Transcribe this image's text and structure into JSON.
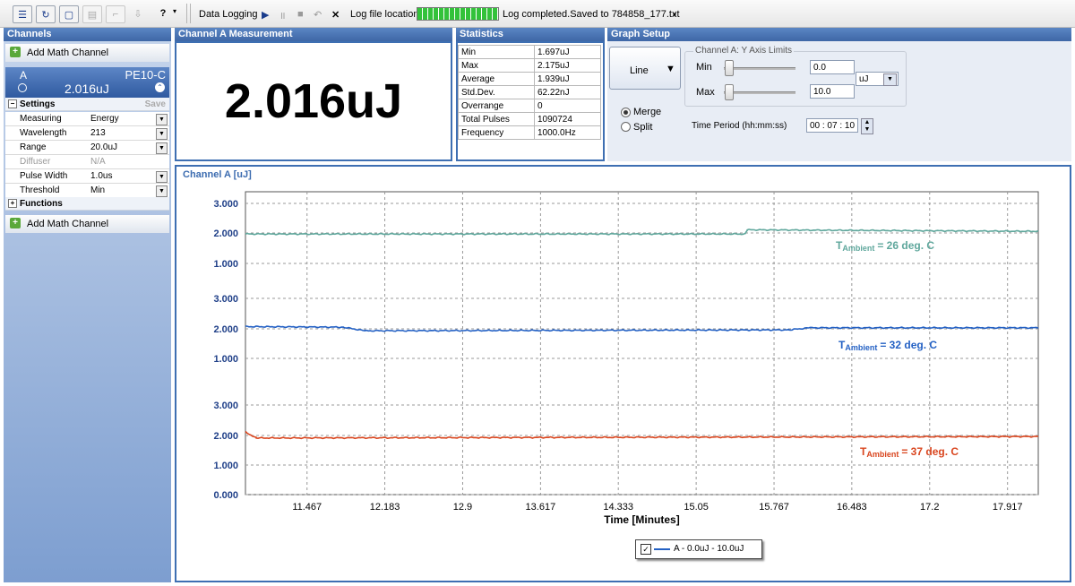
{
  "toolbar": {
    "data_logging": "Data Logging",
    "log_file_location": "Log file location",
    "log_status": "Log completed.Saved to 784858_177.txt"
  },
  "channels": {
    "title": "Channels",
    "add_math_label": "Add Math Channel",
    "channel": {
      "name": "A",
      "sensor": "PE10-C",
      "value": "2.016uJ"
    },
    "settings_label": "Settings",
    "save_label": "Save",
    "settings": [
      {
        "key": "Measuring",
        "value": "Energy",
        "dropdown": true,
        "disabled": false
      },
      {
        "key": "Wavelength",
        "value": "213",
        "dropdown": true,
        "disabled": false
      },
      {
        "key": "Range",
        "value": "20.0uJ",
        "dropdown": true,
        "disabled": false
      },
      {
        "key": "Diffuser",
        "value": "N/A",
        "dropdown": false,
        "disabled": true
      },
      {
        "key": "Pulse Width",
        "value": "1.0us",
        "dropdown": true,
        "disabled": false
      },
      {
        "key": "Threshold",
        "value": "Min",
        "dropdown": true,
        "disabled": false
      }
    ],
    "functions_label": "Functions"
  },
  "measurement": {
    "title": "Channel A Measurement",
    "value": "2.016uJ"
  },
  "statistics": {
    "title": "Statistics",
    "rows": [
      {
        "label": "Min",
        "value": "1.697uJ"
      },
      {
        "label": "Max",
        "value": "2.175uJ"
      },
      {
        "label": "Average",
        "value": "1.939uJ"
      },
      {
        "label": "Std.Dev.",
        "value": "62.22nJ"
      },
      {
        "label": "Overrange",
        "value": "0"
      },
      {
        "label": "Total Pulses",
        "value": "1090724"
      },
      {
        "label": "Frequency",
        "value": "1000.0Hz"
      }
    ]
  },
  "graph_setup": {
    "title": "Graph Setup",
    "graph_type": "Line",
    "merge_label": "Merge",
    "split_label": "Split",
    "mode_selected": "Merge",
    "y_axis_group": "Channel A: Y Axis Limits",
    "min_label": "Min",
    "min_value": "0.0",
    "max_label": "Max",
    "max_value": "10.0",
    "unit": "uJ",
    "time_period_label": "Time Period (hh:mm:ss)",
    "time_period_value": "00 : 07 : 10"
  },
  "chart_panel_title": "Channel A [uJ]",
  "chart_data": {
    "type": "line",
    "xlabel": "Time [Minutes]",
    "x_ticks": [
      "11.467",
      "12.183",
      "12.9",
      "13.617",
      "14.333",
      "15.05",
      "15.767",
      "16.483",
      "17.2",
      "17.917"
    ],
    "xlim": [
      10.9,
      18.2
    ],
    "sub_plots": [
      {
        "y_ticks": [
          "3.000",
          "2.000",
          "1.000"
        ],
        "color": "#5fa79c",
        "annotation_prefix": "T",
        "annotation_sub": "Ambient",
        "annotation_rest": "= 26 deg. C",
        "series": {
          "x": [
            10.9,
            15.5,
            15.52,
            18.2
          ],
          "y": [
            1.98,
            1.98,
            2.12,
            2.07
          ]
        }
      },
      {
        "y_ticks": [
          "3.000",
          "2.000",
          "1.000"
        ],
        "color": "#2461c4",
        "annotation_prefix": "T",
        "annotation_sub": "Ambient",
        "annotation_rest": "= 32 deg. C",
        "series": {
          "x": [
            10.9,
            11.8,
            12.0,
            15.9,
            16.1,
            18.2
          ],
          "y": [
            2.06,
            2.04,
            1.92,
            1.95,
            2.02,
            2.02
          ]
        }
      },
      {
        "y_ticks": [
          "3.000",
          "2.000",
          "1.000",
          "0.000"
        ],
        "color": "#d9461f",
        "annotation_prefix": "T",
        "annotation_sub": "Ambient",
        "annotation_rest": "= 37 deg. C",
        "series": {
          "x": [
            10.9,
            11.0,
            18.2
          ],
          "y": [
            2.1,
            1.9,
            1.95
          ]
        }
      }
    ],
    "grid": true,
    "legend": {
      "label": "A - 0.0uJ - 10.0uJ",
      "checked": true,
      "position": "bottom-center"
    }
  }
}
